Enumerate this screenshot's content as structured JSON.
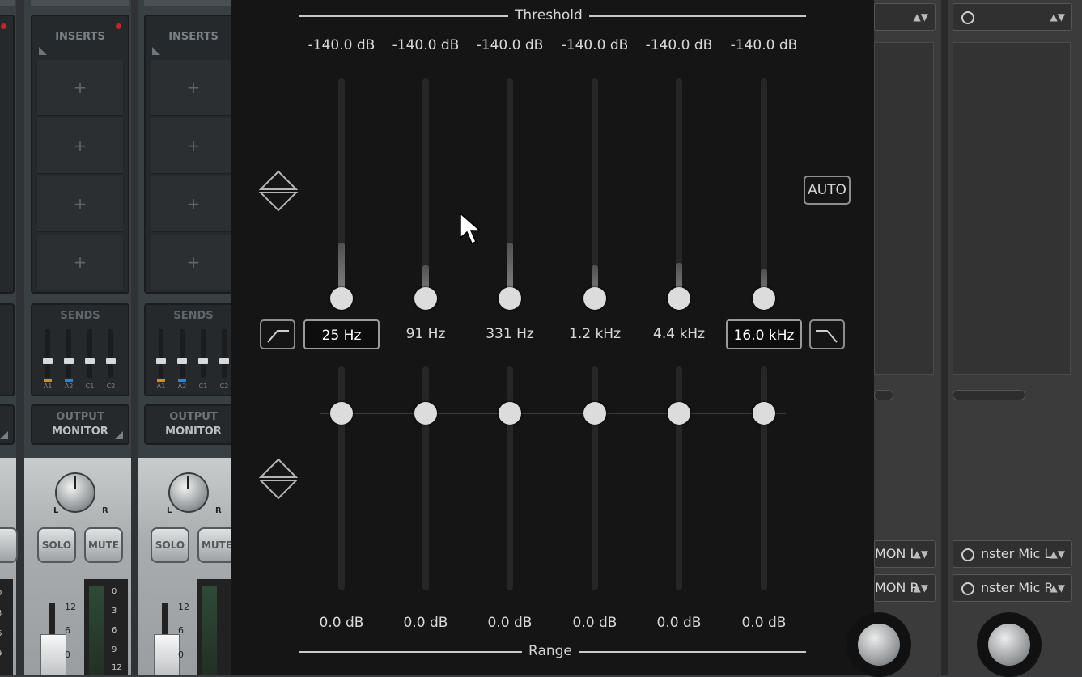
{
  "mixer": {
    "inserts_label": "INSERTS",
    "insert_slot_glyph": "+",
    "sends_label": "SENDS",
    "send_labels": [
      "A1",
      "A2",
      "C1",
      "C2"
    ],
    "output_label": "OUTPUT",
    "output_value": "MONITOR",
    "pan_left": "L",
    "pan_right": "R",
    "solo_label": "SOLO",
    "mute_label": "MUTE",
    "fader_scale": [
      "12",
      "6",
      "0"
    ],
    "meter_scale": [
      "0",
      "3",
      "6",
      "9",
      "12"
    ]
  },
  "eq": {
    "threshold_title": "Threshold",
    "range_title": "Range",
    "auto_label": "AUTO",
    "bands": [
      {
        "threshold": "-140.0 dB",
        "freq": "25 Hz",
        "range": "0.0 dB",
        "meter_level": 0.27
      },
      {
        "threshold": "-140.0 dB",
        "freq": "91 Hz",
        "range": "0.0 dB",
        "meter_level": 0.17
      },
      {
        "threshold": "-140.0 dB",
        "freq": "331 Hz",
        "range": "0.0 dB",
        "meter_level": 0.27
      },
      {
        "threshold": "-140.0 dB",
        "freq": "1.2 kHz",
        "range": "0.0 dB",
        "meter_level": 0.17
      },
      {
        "threshold": "-140.0 dB",
        "freq": "4.4 kHz",
        "range": "0.0 dB",
        "meter_level": 0.18
      },
      {
        "threshold": "-140.0 dB",
        "freq": "16.0 kHz",
        "range": "0.0 dB",
        "meter_level": 0.15
      }
    ]
  },
  "right": {
    "col_a_out_l": "MON L",
    "col_a_out_r": "MON R",
    "col_b_out_l": "nster Mic L",
    "col_b_out_r": "nster Mic R"
  },
  "colors": {
    "send_a1": "#d98a1a",
    "send_a2": "#2a86d4",
    "insert_led": "#c0262a"
  }
}
